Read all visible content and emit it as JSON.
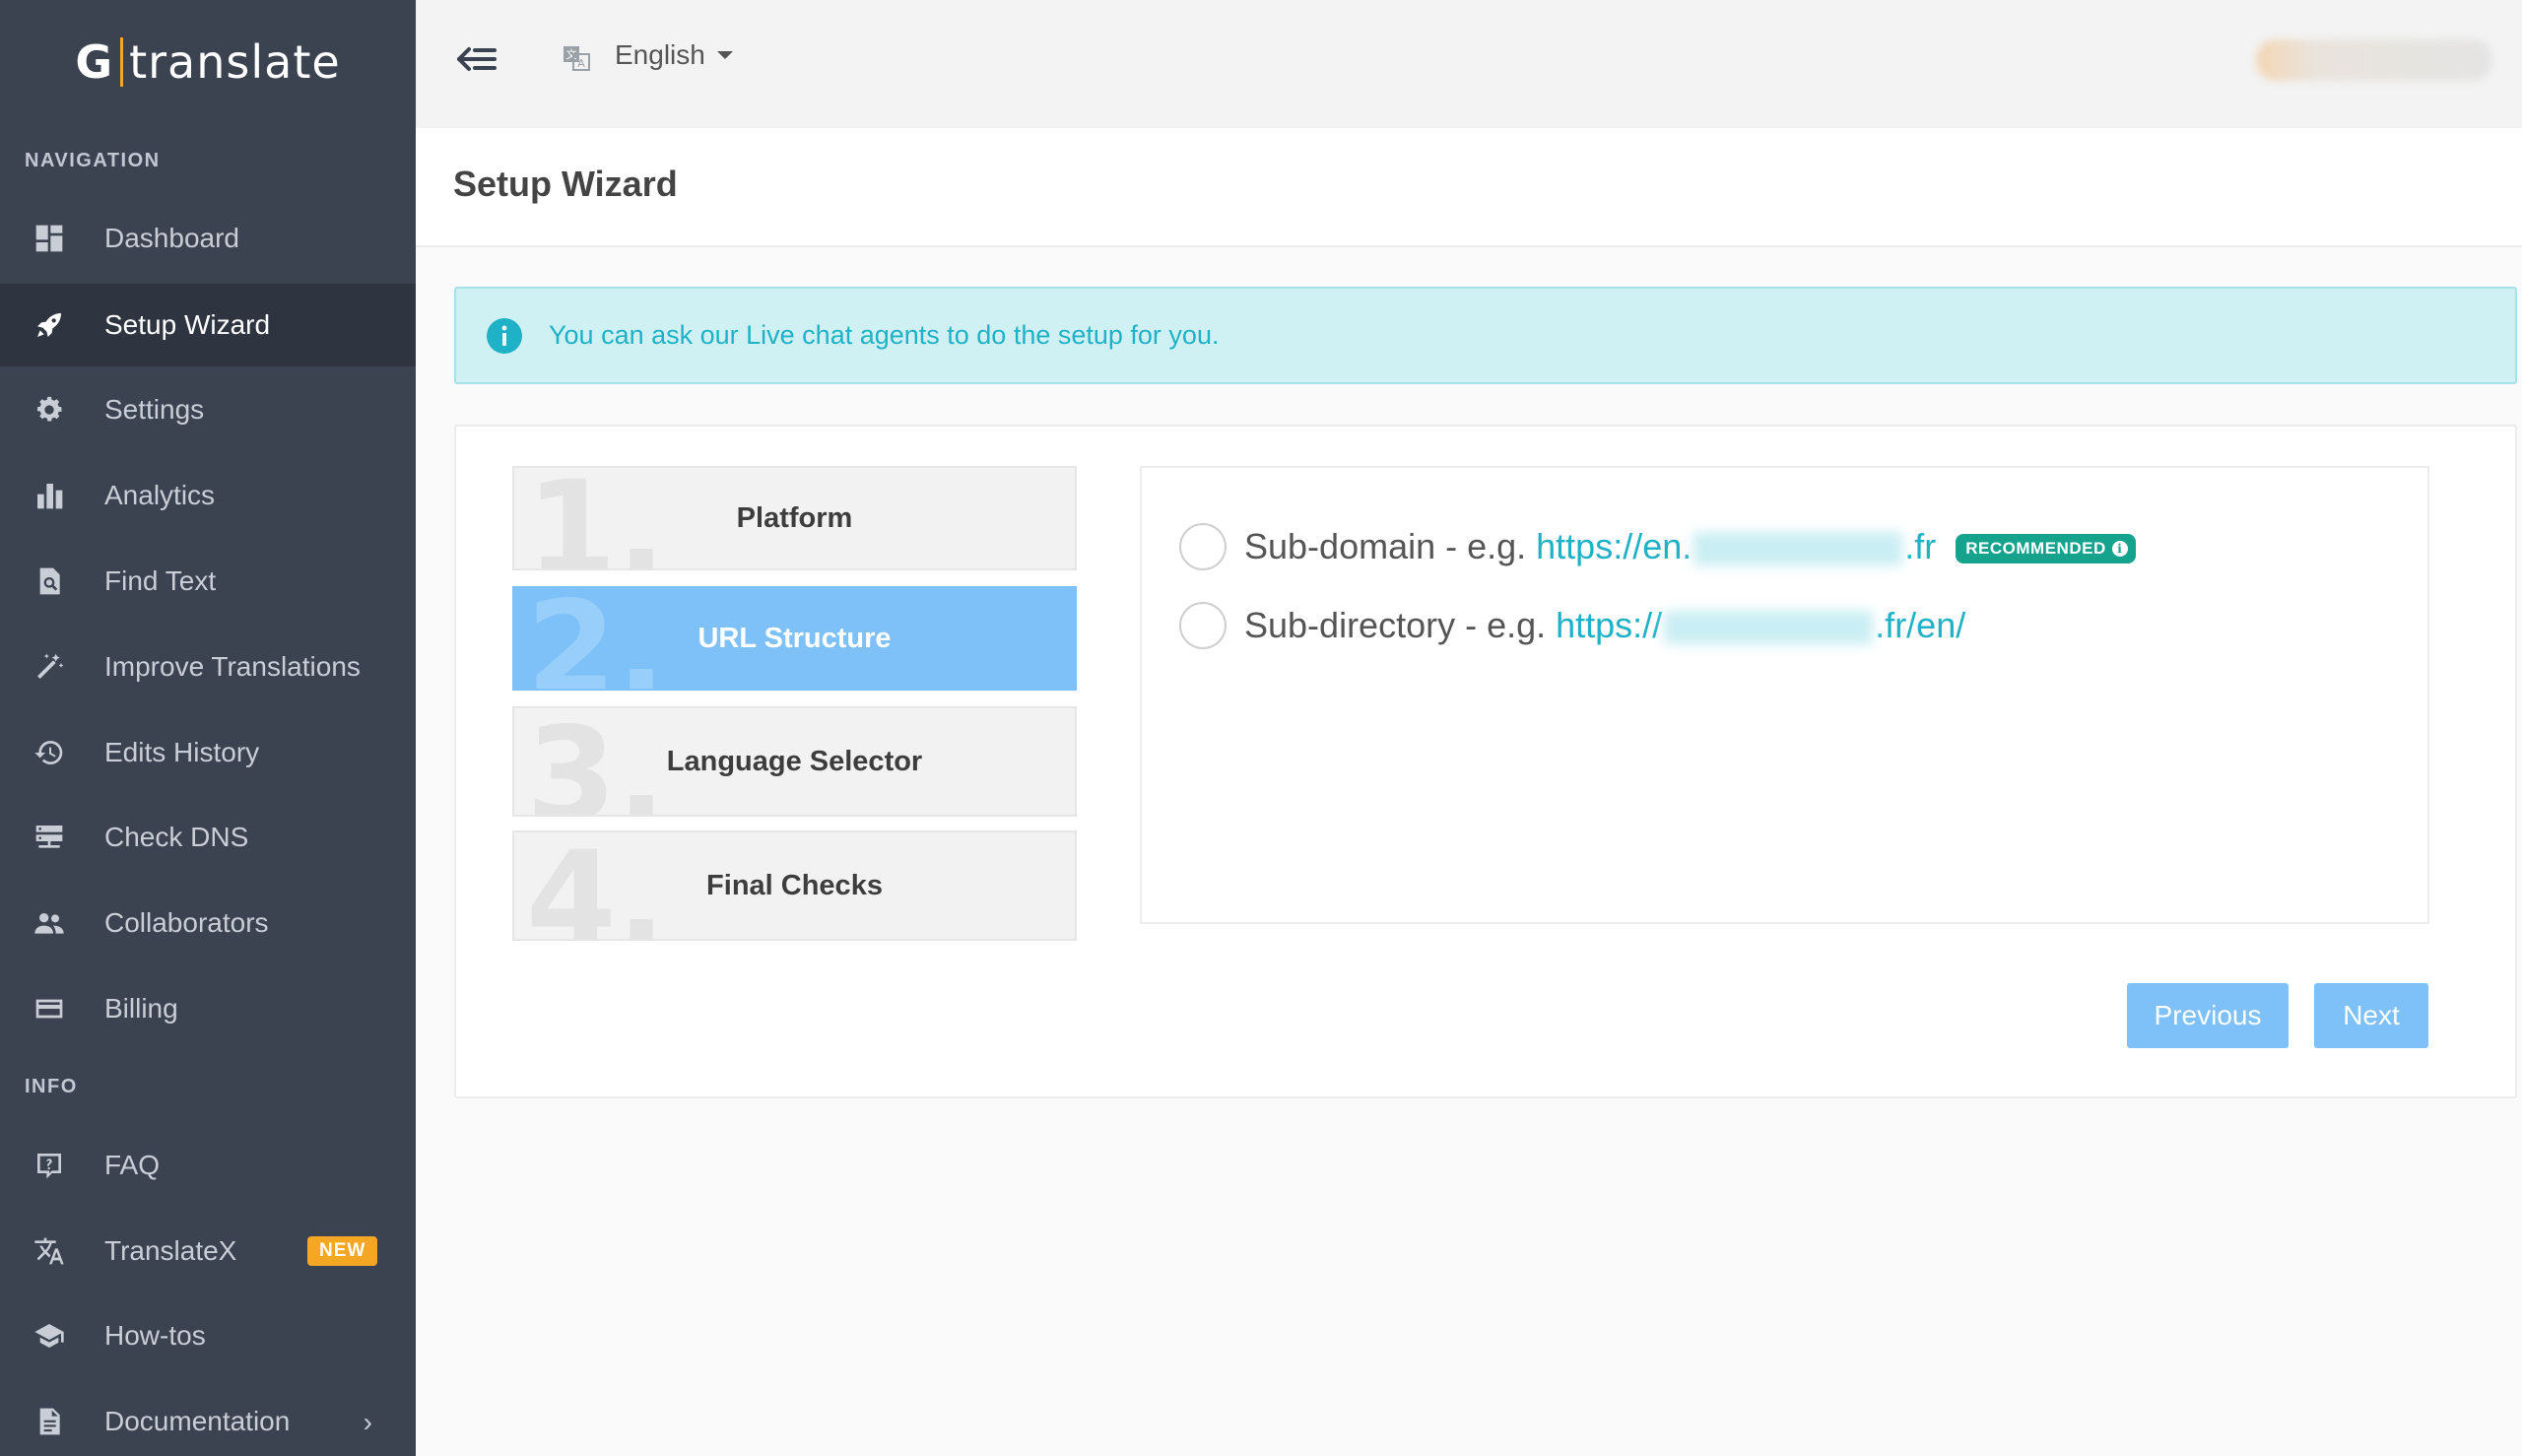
{
  "brand": {
    "g": "G",
    "word": "translate"
  },
  "sidebar": {
    "nav_heading": "NAVIGATION",
    "info_heading": "INFO",
    "items": [
      {
        "label": "Dashboard",
        "icon": "dashboard-icon"
      },
      {
        "label": "Setup Wizard",
        "icon": "rocket-icon",
        "active": true
      },
      {
        "label": "Settings",
        "icon": "gear-icon"
      },
      {
        "label": "Analytics",
        "icon": "bar-chart-icon"
      },
      {
        "label": "Find Text",
        "icon": "find-file-icon"
      },
      {
        "label": "Improve Translations",
        "icon": "magic-wand-icon"
      },
      {
        "label": "Edits History",
        "icon": "history-icon"
      },
      {
        "label": "Check DNS",
        "icon": "server-icon"
      },
      {
        "label": "Collaborators",
        "icon": "users-icon"
      },
      {
        "label": "Billing",
        "icon": "credit-card-icon"
      }
    ],
    "info_items": [
      {
        "label": "FAQ",
        "icon": "help-icon"
      },
      {
        "label": "TranslateX",
        "icon": "translate-icon",
        "badge": "NEW"
      },
      {
        "label": "How-tos",
        "icon": "graduation-cap-icon"
      },
      {
        "label": "Documentation",
        "icon": "document-icon",
        "chevron": "›"
      }
    ]
  },
  "topbar": {
    "language": "English"
  },
  "page": {
    "title": "Setup Wizard"
  },
  "alert": {
    "text": "You can ask our Live chat agents to do the setup for you."
  },
  "wizard": {
    "steps": [
      {
        "num": "1.",
        "label": "Platform"
      },
      {
        "num": "2.",
        "label": "URL Structure",
        "active": true
      },
      {
        "num": "3.",
        "label": "Language Selector"
      },
      {
        "num": "4.",
        "label": "Final Checks"
      }
    ],
    "options": [
      {
        "prefix": "Sub-domain - e.g. ",
        "link_start": "https://en.",
        "link_end": ".fr",
        "badge": "RECOMMENDED",
        "selected": false
      },
      {
        "prefix": "Sub-directory - e.g. ",
        "link_start": "https://",
        "link_end": ".fr/en/",
        "selected": false
      }
    ],
    "previous_label": "Previous",
    "next_label": "Next"
  },
  "colors": {
    "sidebar_bg": "#3b4250",
    "sidebar_active": "#2f3540",
    "accent": "#7ec0f8",
    "info_text": "#1fb2c6",
    "badge_orange": "#f5a623",
    "badge_green": "#16a38e"
  }
}
